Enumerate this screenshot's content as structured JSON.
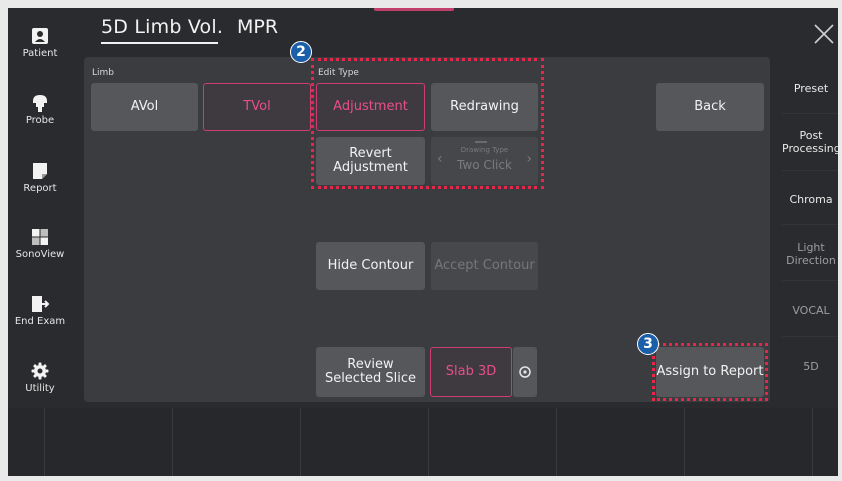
{
  "title": {
    "main": "5D Limb Vol.",
    "mpr": "MPR"
  },
  "left_sidebar": [
    {
      "label": "Patient",
      "icon": "patient-icon"
    },
    {
      "label": "Probe",
      "icon": "probe-icon"
    },
    {
      "label": "Report",
      "icon": "report-icon"
    },
    {
      "label": "SonoView",
      "icon": "sonoview-icon"
    },
    {
      "label": "End Exam",
      "icon": "end-exam-icon"
    },
    {
      "label": "Utility",
      "icon": "gear-icon"
    }
  ],
  "sections": {
    "limb": "Limb",
    "edit_type": "Edit Type"
  },
  "limb_buttons": {
    "avol": "AVol",
    "tvol": "TVol"
  },
  "edit_buttons": {
    "adjustment": "Adjustment",
    "redrawing": "Redrawing",
    "revert_adjustment": "Revert\nAdjustment",
    "drawing_type_caption": "Drawing Type",
    "drawing_type_value": "Two Click"
  },
  "back": "Back",
  "contour": {
    "hide": "Hide Contour",
    "accept": "Accept Contour"
  },
  "bottom_controls": {
    "review": "Review\nSelected Slice",
    "slab": "Slab 3D",
    "assign": "Assign to Report"
  },
  "markers": {
    "m2": "2",
    "m3": "3"
  },
  "right_sidebar": [
    {
      "label": "Preset",
      "enabled": true
    },
    {
      "label": "Post\nProcessing",
      "enabled": true
    },
    {
      "label": "Chroma",
      "enabled": true
    },
    {
      "label": "Light\nDirection",
      "enabled": false
    },
    {
      "label": "VOCAL",
      "enabled": false
    },
    {
      "label": "5D",
      "enabled": false
    }
  ],
  "colors": {
    "accent": "#e84f8a",
    "highlight": "#e8264a",
    "marker": "#1b5fa8"
  }
}
